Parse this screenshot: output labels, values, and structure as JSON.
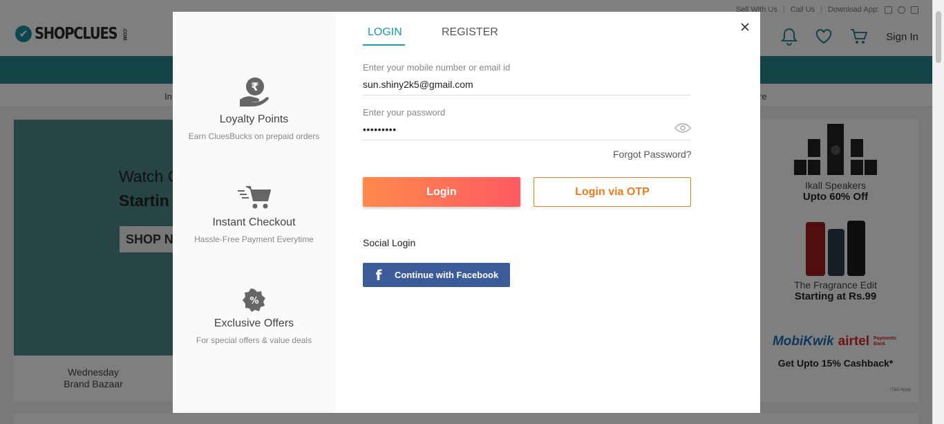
{
  "header": {
    "toplinks": [
      "Sell With Us",
      "Call Us",
      "Download App:"
    ],
    "download_icons": [
      "android-icon",
      "apple-icon",
      "windows-icon"
    ],
    "logo_text": "SHOPCLUES",
    "logo_suffix": ".COM",
    "icons": [
      "bell-icon",
      "heart-icon",
      "cart-icon"
    ],
    "signin_label": "Sign In"
  },
  "nav": {
    "left_fragment": "In",
    "right_fragment": "re"
  },
  "banner": {
    "line1": "Watch C",
    "line2": "Startin",
    "shop_button": "SHOP N",
    "strip_line1": "Wednesday",
    "strip_line2": "Brand Bazaar"
  },
  "right_column": [
    {
      "title": "Ikall Speakers",
      "subtitle": "Upto 60% Off"
    },
    {
      "title": "The Fragrance Edit",
      "subtitle": "Starting at Rs.99"
    },
    {
      "brand1": "MobiKwik",
      "brand2": "airtel",
      "brand2_sub": "Payments Bank",
      "subtitle": "Get Upto 15% Cashback*",
      "note": "*T&C Apply"
    }
  ],
  "modal": {
    "perks": [
      {
        "icon": "rupee-hand-icon",
        "title": "Loyalty Points",
        "desc": "Earn CluesBucks on prepaid orders"
      },
      {
        "icon": "cart-speed-icon",
        "title": "Instant Checkout",
        "desc": "Hassle-Free Payment Everytime"
      },
      {
        "icon": "percent-badge-icon",
        "title": "Exclusive Offers",
        "desc": "For special offers & value deals"
      }
    ],
    "tabs": {
      "login": "LOGIN",
      "register": "REGISTER"
    },
    "active_tab": "login",
    "email": {
      "label": "Enter your mobile number or email id",
      "value": "sun.shiny2k5@gmail.com"
    },
    "password": {
      "label": "Enter your password",
      "value": "•••••••••"
    },
    "forgot_label": "Forgot Password?",
    "login_button": "Login",
    "otp_button": "Login via OTP",
    "social_label": "Social Login",
    "facebook_button": "Continue with Facebook",
    "colors": {
      "accent": "#1c9aa6",
      "login_gradient_start": "#ff8a4c",
      "login_gradient_end": "#ff5a62",
      "otp": "#f07a1a",
      "facebook": "#3b5b99"
    }
  }
}
